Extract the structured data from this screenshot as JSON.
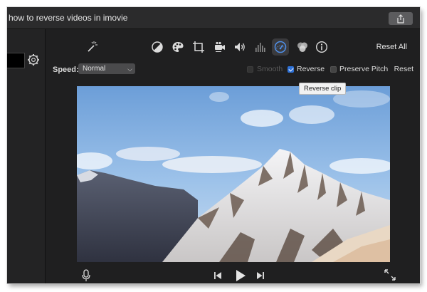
{
  "window": {
    "title": "how to reverse videos in imovie",
    "share_icon": "share-icon"
  },
  "left_panel": {
    "gear_icon": "gear-icon"
  },
  "toolbar": {
    "icons": [
      "magic-wand-icon",
      "color-balance-icon",
      "color-palette-icon",
      "crop-icon",
      "stabilization-icon",
      "volume-icon",
      "equalizer-icon",
      "speed-gauge-icon",
      "clip-filter-icon",
      "info-icon"
    ],
    "active_icon": "speed-gauge-icon",
    "reset_all_label": "Reset All"
  },
  "speed": {
    "label": "Speed:",
    "selected": "Normal"
  },
  "options": {
    "smooth_label": "Smooth",
    "smooth_checked": false,
    "smooth_enabled": false,
    "reverse_label": "Reverse",
    "reverse_checked": true,
    "preserve_pitch_label": "Preserve Pitch",
    "preserve_pitch_checked": false,
    "reset_label": "Reset"
  },
  "tooltip": {
    "text": "Reverse clip"
  },
  "transport": {
    "icons": [
      "microphone-icon",
      "skip-back-icon",
      "play-icon",
      "skip-forward-icon",
      "fullscreen-icon"
    ]
  },
  "colors": {
    "accent": "#2f72d8",
    "background": "#1f1f20",
    "titlebar": "#2b2b2c"
  }
}
